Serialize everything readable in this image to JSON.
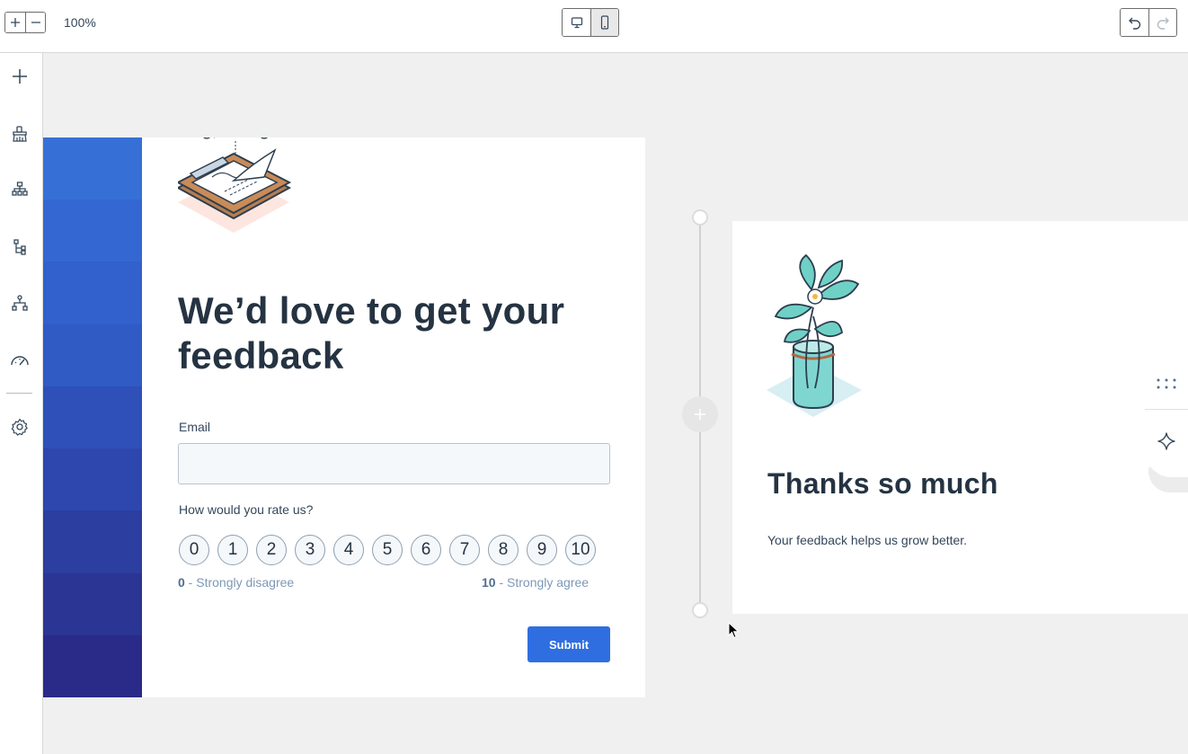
{
  "toolbar": {
    "zoom_in_icon": "plus-icon",
    "zoom_out_icon": "minus-icon",
    "zoom_level": "100%",
    "device_desktop_icon": "desktop-icon",
    "device_mobile_icon": "mobile-icon",
    "undo_icon": "undo-icon",
    "redo_icon": "redo-icon"
  },
  "left_rail": {
    "items": [
      {
        "icon": "plus-icon"
      },
      {
        "icon": "paint-brush-icon"
      },
      {
        "icon": "org-chart-icon"
      },
      {
        "icon": "tree-structure-icon"
      },
      {
        "icon": "sitemap-icon"
      },
      {
        "icon": "gauge-icon"
      },
      {
        "icon": "gear-icon"
      }
    ]
  },
  "form_page": {
    "title": "We’d love to get your feedback",
    "email_label": "Email",
    "email_value": "",
    "rating_question": "How would you rate us?",
    "rating_options": [
      "0",
      "1",
      "2",
      "3",
      "4",
      "5",
      "6",
      "7",
      "8",
      "9",
      "10"
    ],
    "scale_min_value": "0",
    "scale_min_text": " - Strongly disagree",
    "scale_max_value": "10",
    "scale_max_text": " - Strongly agree",
    "submit_label": "Submit",
    "stripe_colors": [
      "#3670d6",
      "#3467d2",
      "#3260cc",
      "#305ac4",
      "#2e50b8",
      "#2d47ae",
      "#2c3e9f",
      "#2b3593",
      "#2a2a88"
    ]
  },
  "thanks_page": {
    "title": "Thanks so much",
    "text": "Your feedback helps us grow better."
  },
  "colors": {
    "accent": "#2f6ee0",
    "heading": "#253342",
    "canvas_bg": "#f0f0f0"
  }
}
